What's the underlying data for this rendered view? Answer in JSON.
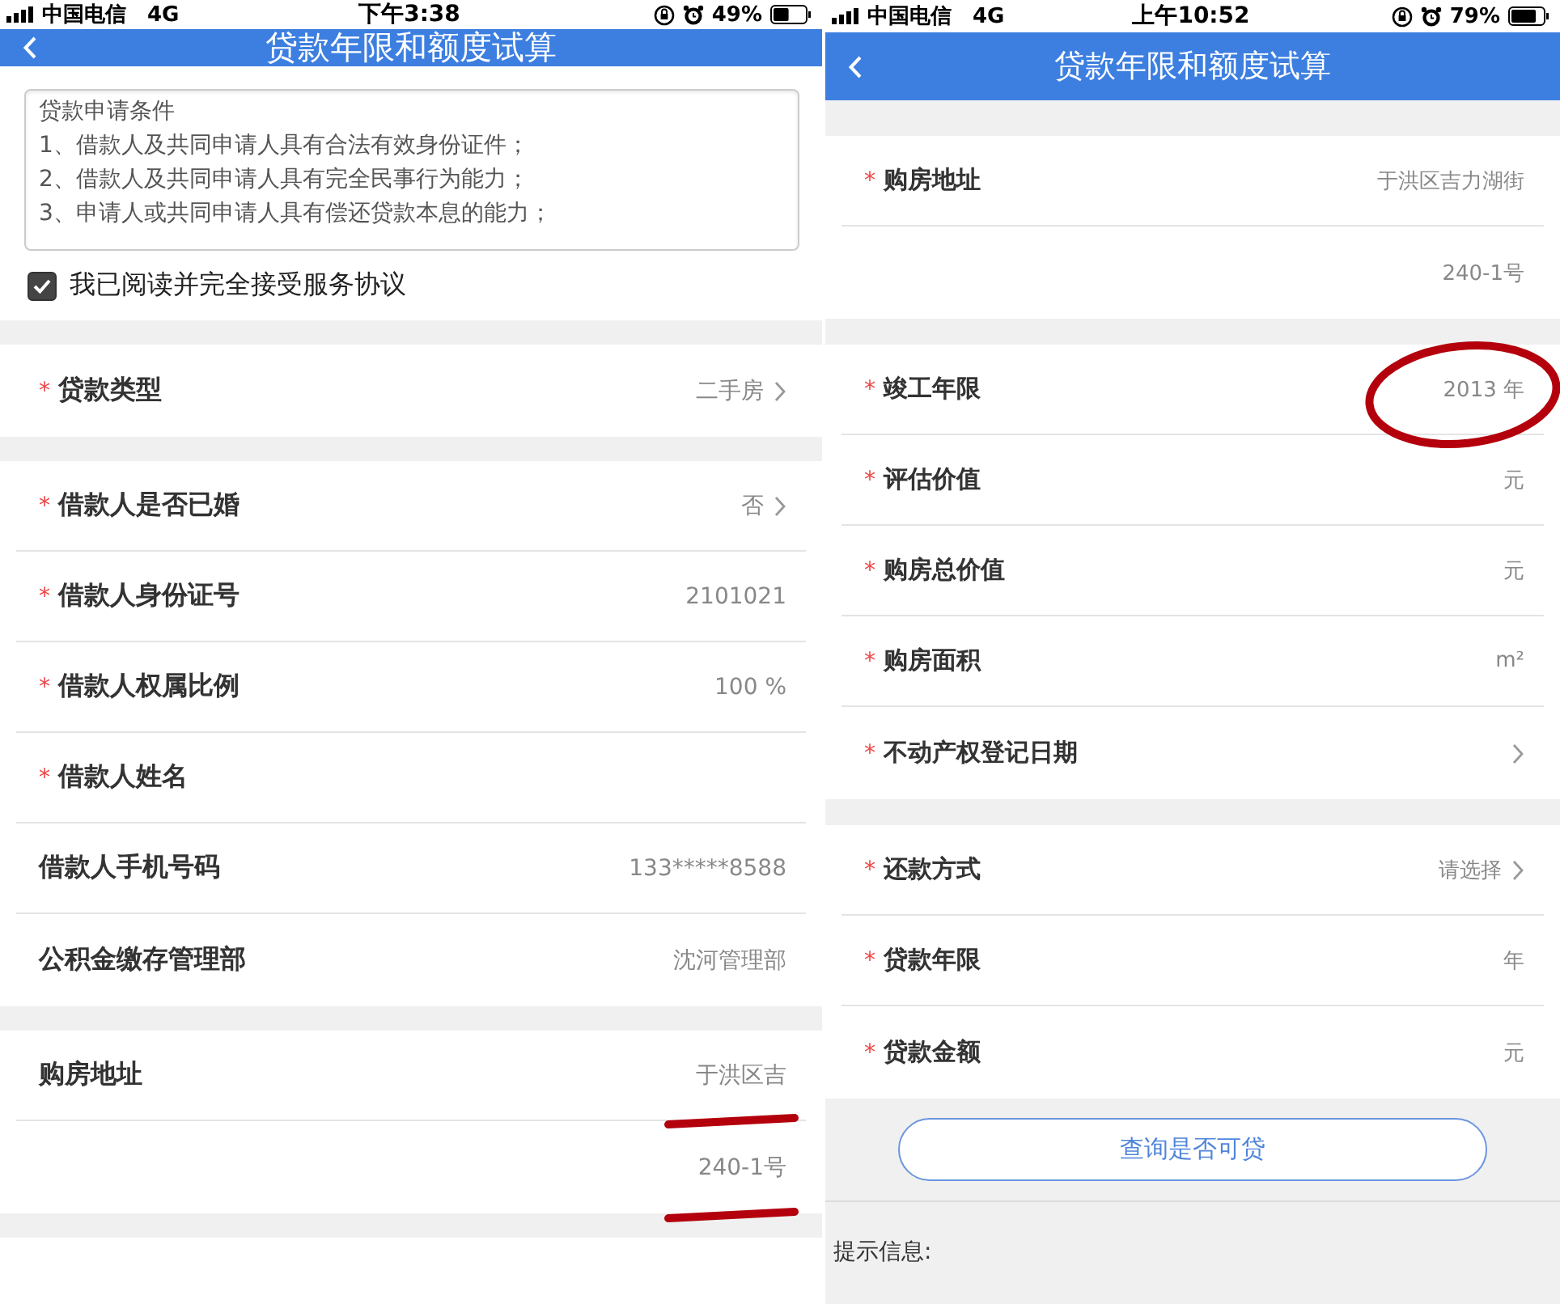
{
  "screens": [
    {
      "status_bar": {
        "carrier": "中国电信",
        "network": "4G",
        "time": "下午3:38",
        "battery": "49%"
      },
      "title": "贷款年限和额度试算",
      "content": [
        {
          "kind": "terms",
          "lines": [
            "贷款申请条件",
            "1、借款人及共同申请人具有合法有效身份证件；",
            "2、借款人及共同申请人具有完全民事行为能力；",
            "3、申请人或共同申请人具有偿还贷款本息的能力；"
          ]
        },
        {
          "kind": "agreement",
          "label": "我已阅读并完全接受服务协议",
          "checked": true
        },
        {
          "kind": "group",
          "rows": [
            {
              "required_mark": "*",
              "label": "贷款类型",
              "value": "二手房",
              "chevron": true
            }
          ]
        },
        {
          "kind": "group",
          "rows": [
            {
              "required_mark": "*",
              "label": "借款人是否已婚",
              "value": "否",
              "chevron": true
            },
            {
              "required_mark": "*",
              "label": "借款人身份证号",
              "value": "2101021",
              "chevron": false
            },
            {
              "required_mark": "*",
              "label": "借款人权属比例",
              "value": "100 %",
              "chevron": false
            },
            {
              "required_mark": "*",
              "label": "借款人姓名",
              "chevron": false
            },
            {
              "label": "借款人手机号码",
              "value": "133*****8588",
              "chevron": false
            },
            {
              "label": "公积金缴存管理部",
              "value": "沈河管理部",
              "chevron": false
            }
          ]
        },
        {
          "kind": "group",
          "rows": [
            {
              "label": "购房地址",
              "value": "于洪区吉",
              "chevron": false,
              "underlined": true
            },
            {
              "value": "240-1号",
              "chevron": false,
              "underlined": true
            }
          ]
        },
        {
          "kind": "group",
          "rows": [
            {
              "chevron": false
            }
          ]
        }
      ]
    },
    {
      "status_bar": {
        "carrier": "中国电信",
        "network": "4G",
        "time": "上午10:52",
        "battery": "79%"
      },
      "title": "贷款年限和额度试算",
      "content": [
        {
          "kind": "group",
          "rows": [
            {
              "required_mark": "*",
              "label": "购房地址",
              "value": "于洪区吉力湖街",
              "chevron": false
            },
            {
              "value": "240-1号",
              "chevron": false
            }
          ]
        },
        {
          "kind": "group",
          "rows": [
            {
              "required_mark": "*",
              "label": "竣工年限",
              "value": "2013 年",
              "chevron": false,
              "circled": true
            },
            {
              "required_mark": "*",
              "label": "评估价值",
              "value": "元",
              "chevron": false
            },
            {
              "required_mark": "*",
              "label": "购房总价值",
              "value": "元",
              "chevron": false
            },
            {
              "required_mark": "*",
              "label": "购房面积",
              "value": "m²",
              "chevron": false
            },
            {
              "required_mark": "*",
              "label": "不动产权登记日期",
              "chevron": true
            }
          ]
        },
        {
          "kind": "group",
          "rows": [
            {
              "required_mark": "*",
              "label": "还款方式",
              "value": "请选择",
              "chevron": true
            },
            {
              "required_mark": "*",
              "label": "贷款年限",
              "value": "年",
              "chevron": false
            },
            {
              "required_mark": "*",
              "label": "贷款金额",
              "value": "元",
              "chevron": false
            }
          ]
        },
        {
          "kind": "button",
          "label": "查询是否可贷"
        },
        {
          "kind": "hint",
          "label": "提示信息:"
        }
      ]
    }
  ]
}
